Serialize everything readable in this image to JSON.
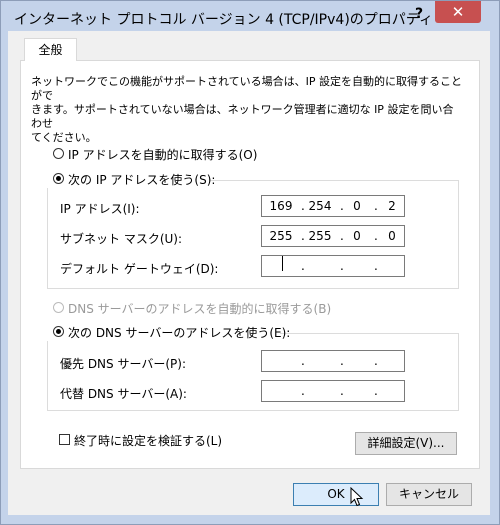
{
  "window": {
    "title": "インターネット プロトコル バージョン 4 (TCP/IPv4)のプロパティ",
    "help_label": "?",
    "close_label": "✕"
  },
  "tabs": [
    {
      "label": "全般",
      "selected": true
    }
  ],
  "description": [
    "ネットワークでこの機能がサポートされている場合は、IP 設定を自動的に取得することがで",
    "きます。サポートされていない場合は、ネットワーク管理者に適切な IP 設定を問い合わせ",
    "てください。"
  ],
  "ip_settings": {
    "auto_label": "IP アドレスを自動的に取得する(O)",
    "manual_label": "次の IP アドレスを使う(S):",
    "selected": "manual",
    "fields": {
      "ip_address": {
        "label": "IP アドレス(I):",
        "octets": [
          "169",
          "254",
          "0",
          "2"
        ]
      },
      "subnet_mask": {
        "label": "サブネット マスク(U):",
        "octets": [
          "255",
          "255",
          "0",
          "0"
        ]
      },
      "default_gateway": {
        "label": "デフォルト ゲートウェイ(D):",
        "octets": [
          "",
          "",
          "",
          ""
        ]
      }
    }
  },
  "dns_settings": {
    "auto_label": "DNS サーバーのアドレスを自動的に取得する(B)",
    "auto_enabled": false,
    "manual_label": "次の DNS サーバーのアドレスを使う(E):",
    "selected": "manual",
    "fields": {
      "preferred": {
        "label": "優先 DNS サーバー(P):",
        "octets": [
          "",
          "",
          "",
          ""
        ]
      },
      "alternate": {
        "label": "代替 DNS サーバー(A):",
        "octets": [
          "",
          "",
          "",
          ""
        ]
      }
    }
  },
  "validate_on_exit": {
    "label": "終了時に設定を検証する(L)",
    "checked": false
  },
  "buttons": {
    "advanced": "詳細設定(V)...",
    "ok": "OK",
    "cancel": "キャンセル"
  },
  "ip_separator": "."
}
